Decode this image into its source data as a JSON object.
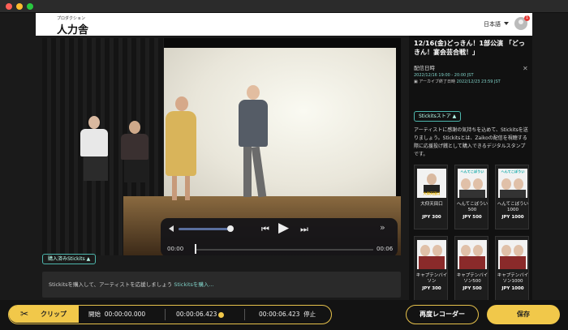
{
  "header": {
    "logo_small": "プロダクション",
    "logo_big": "人力舎",
    "language": "日本語",
    "notification_count": "1"
  },
  "player": {
    "time_current": "00:00",
    "time_total": "00:06"
  },
  "stickits_tag": "購入済みStickits ▲",
  "support": {
    "text": "Stickitsを購入して、アーティストを応援しましょう ",
    "link": "Stickitsを購入..."
  },
  "sidebar": {
    "title": "12/16(金)どっきん！1部公演 「どっきん！宴会芸合戦！」",
    "schedule_label": "配信日時",
    "schedule_value": "2022/12/16 19:00 - 20:00 JST",
    "archive_label": "アーカイブ終了日時",
    "archive_value": "2022/12/23 23:59 JST",
    "store_button": "Stickitsストア ▲",
    "description": "アーティストに感謝の気持ちを込めて、Stickitsを送りましょう。Stickitsとは、Zaikoの配信を視聴する際に応援投げ銭として購入できるデジタルスタンプです。",
    "cards": [
      {
        "name": "大仰天田口",
        "price": "JPY 300",
        "thumb_text": "大仰天田口"
      },
      {
        "name": "へんてこぼうい500",
        "price": "JPY 500",
        "thumb_text": "へんてこぼうい"
      },
      {
        "name": "へんてこぼうい1000",
        "price": "JPY 1000",
        "thumb_text": "へんてこぼうい"
      },
      {
        "name": "キャプテンバイソン",
        "price": "JPY 300",
        "thumb_text": ""
      },
      {
        "name": "キャプテンバイソン500",
        "price": "JPY 500",
        "thumb_text": ""
      },
      {
        "name": "キャプテンバイソン1000",
        "price": "JPY 1000",
        "thumb_text": ""
      }
    ]
  },
  "bottombar": {
    "clip_label": "クリップ",
    "start_label": "開始",
    "start_value": "00:00:00.000",
    "mid_value": "00:00:06.423",
    "stop_value": "00:00:06.423",
    "stop_label": "停止",
    "rerecord_label": "再度レコーダー",
    "save_label": "保存"
  },
  "colors": {
    "accent": "#f1c84a",
    "teal": "#4db6ac"
  }
}
